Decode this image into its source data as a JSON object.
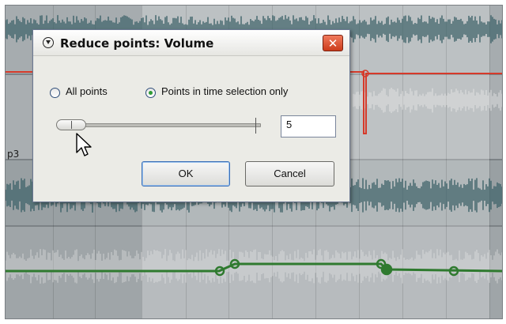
{
  "dialog": {
    "title": "Reduce points: Volume",
    "close_icon_glyph": "✕",
    "app_icon": "reaper-icon",
    "options": [
      {
        "label": "All points",
        "checked": false
      },
      {
        "label": "Points in time selection only",
        "checked": true
      }
    ],
    "slider": {
      "value": 5,
      "min": 1
    },
    "value_input": "5",
    "buttons": {
      "ok": "OK",
      "cancel": "Cancel"
    }
  },
  "tracks": {
    "label_fragment": "p3"
  },
  "colors": {
    "volume_envelope": "#d63a2a",
    "green_envelope": "#2f7a2f",
    "waveform": "#3a5f66",
    "dialog_bg": "#ebebe6",
    "close_button": "#d94b2b"
  },
  "icons": [
    "reaper-icon",
    "close-icon",
    "cursor-icon"
  ]
}
